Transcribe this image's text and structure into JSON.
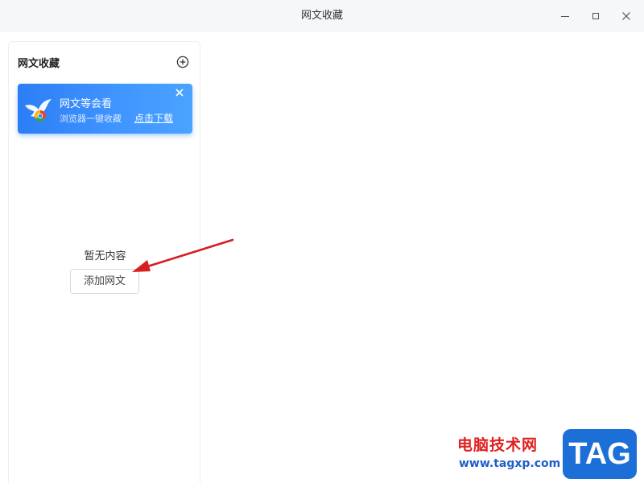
{
  "window": {
    "title": "网文收藏",
    "controls": [
      "minimize-icon",
      "maximize-icon",
      "close-icon"
    ]
  },
  "sidebar": {
    "title": "网文收藏",
    "add_icon": "plus-circle-icon",
    "banner": {
      "title": "网文等会看",
      "subtitle": "浏览器一键收藏",
      "link": "点击下载",
      "close_icon": "close-icon",
      "logo_icon": "bird-chrome-logo-icon",
      "color": "#2f86f8"
    },
    "empty_state": {
      "message": "暂无内容",
      "button_label": "添加网文"
    }
  },
  "annotation": {
    "arrow_color": "#e02020"
  },
  "watermark": {
    "site_name": "电脑技术网",
    "url": "www.tagxp.com",
    "badge": "TAG"
  }
}
